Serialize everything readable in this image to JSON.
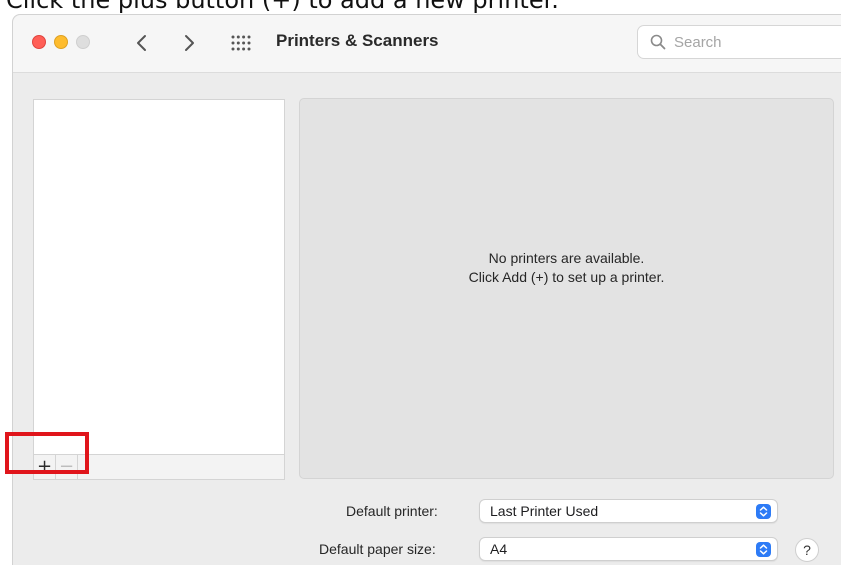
{
  "caption": "Click the plus button (+) to add a new printer.",
  "window": {
    "title": "Printers & Scanners",
    "traffic_lights": [
      "red",
      "yellow",
      "gray"
    ],
    "icons": {
      "back": "chevron-left-icon",
      "forward": "chevron-right-icon",
      "show_all": "grid-icon",
      "search": "magnifying-glass-icon"
    }
  },
  "search": {
    "placeholder": "Search",
    "value": ""
  },
  "printer_list": {
    "items": [],
    "add_label": "+",
    "remove_label": "−"
  },
  "detail": {
    "message_line1": "No printers are available.",
    "message_line2": "Click Add (+) to set up a printer."
  },
  "settings": {
    "default_printer_label": "Default printer:",
    "default_printer_value": "Last Printer Used",
    "paper_size_label": "Default paper size:",
    "paper_size_value": "A4"
  },
  "help_label": "?",
  "colors": {
    "highlight": "#e0151b",
    "accent": "#2d7bf6",
    "close": "#ff5f57",
    "minimize": "#febc2e"
  }
}
